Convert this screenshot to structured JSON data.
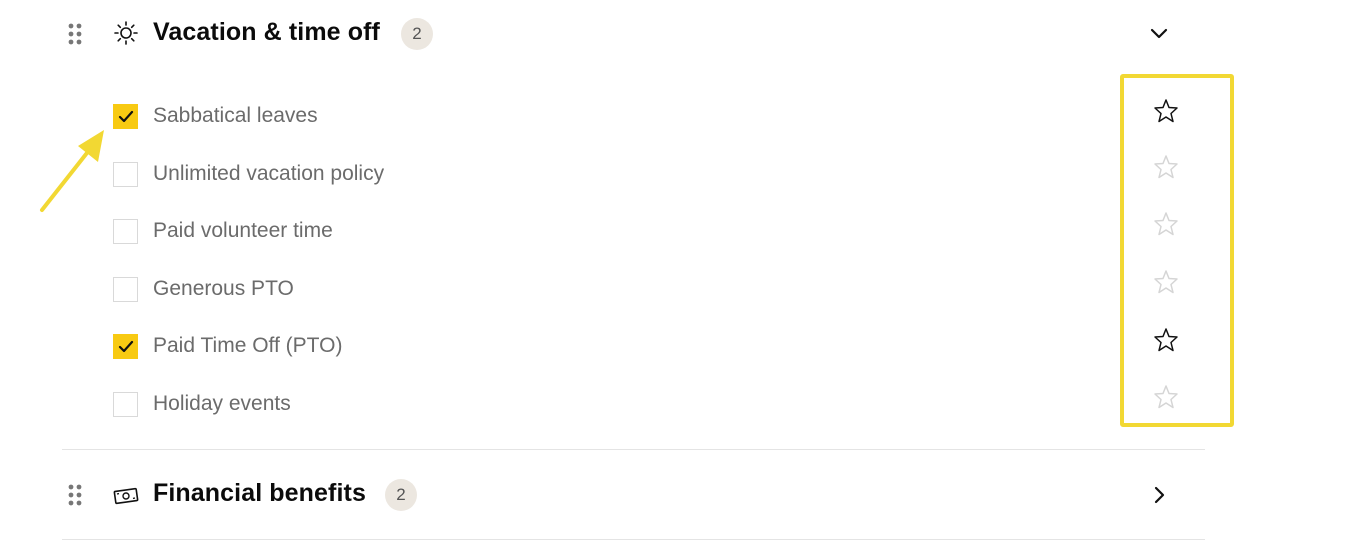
{
  "sections": [
    {
      "title": "Vacation & time off",
      "count": "2",
      "icon": "sun-icon",
      "expanded": true
    },
    {
      "title": "Financial benefits",
      "count": "2",
      "icon": "money-icon",
      "expanded": false
    }
  ],
  "options": [
    {
      "label": "Sabbatical leaves",
      "checked": true,
      "starred": true
    },
    {
      "label": "Unlimited vacation policy",
      "checked": false,
      "starred": false
    },
    {
      "label": "Paid volunteer time",
      "checked": false,
      "starred": false
    },
    {
      "label": "Generous PTO",
      "checked": false,
      "starred": false
    },
    {
      "label": "Paid Time Off (PTO)",
      "checked": true,
      "starred": true
    },
    {
      "label": "Holiday events",
      "checked": false,
      "starred": false
    }
  ],
  "colors": {
    "accent": "#f8ca12",
    "annotation": "#f2d833",
    "badge_bg": "#ece7e0",
    "label_text": "#6b6b6b",
    "star_active": "#111111",
    "star_inactive": "#d5d5d5"
  }
}
